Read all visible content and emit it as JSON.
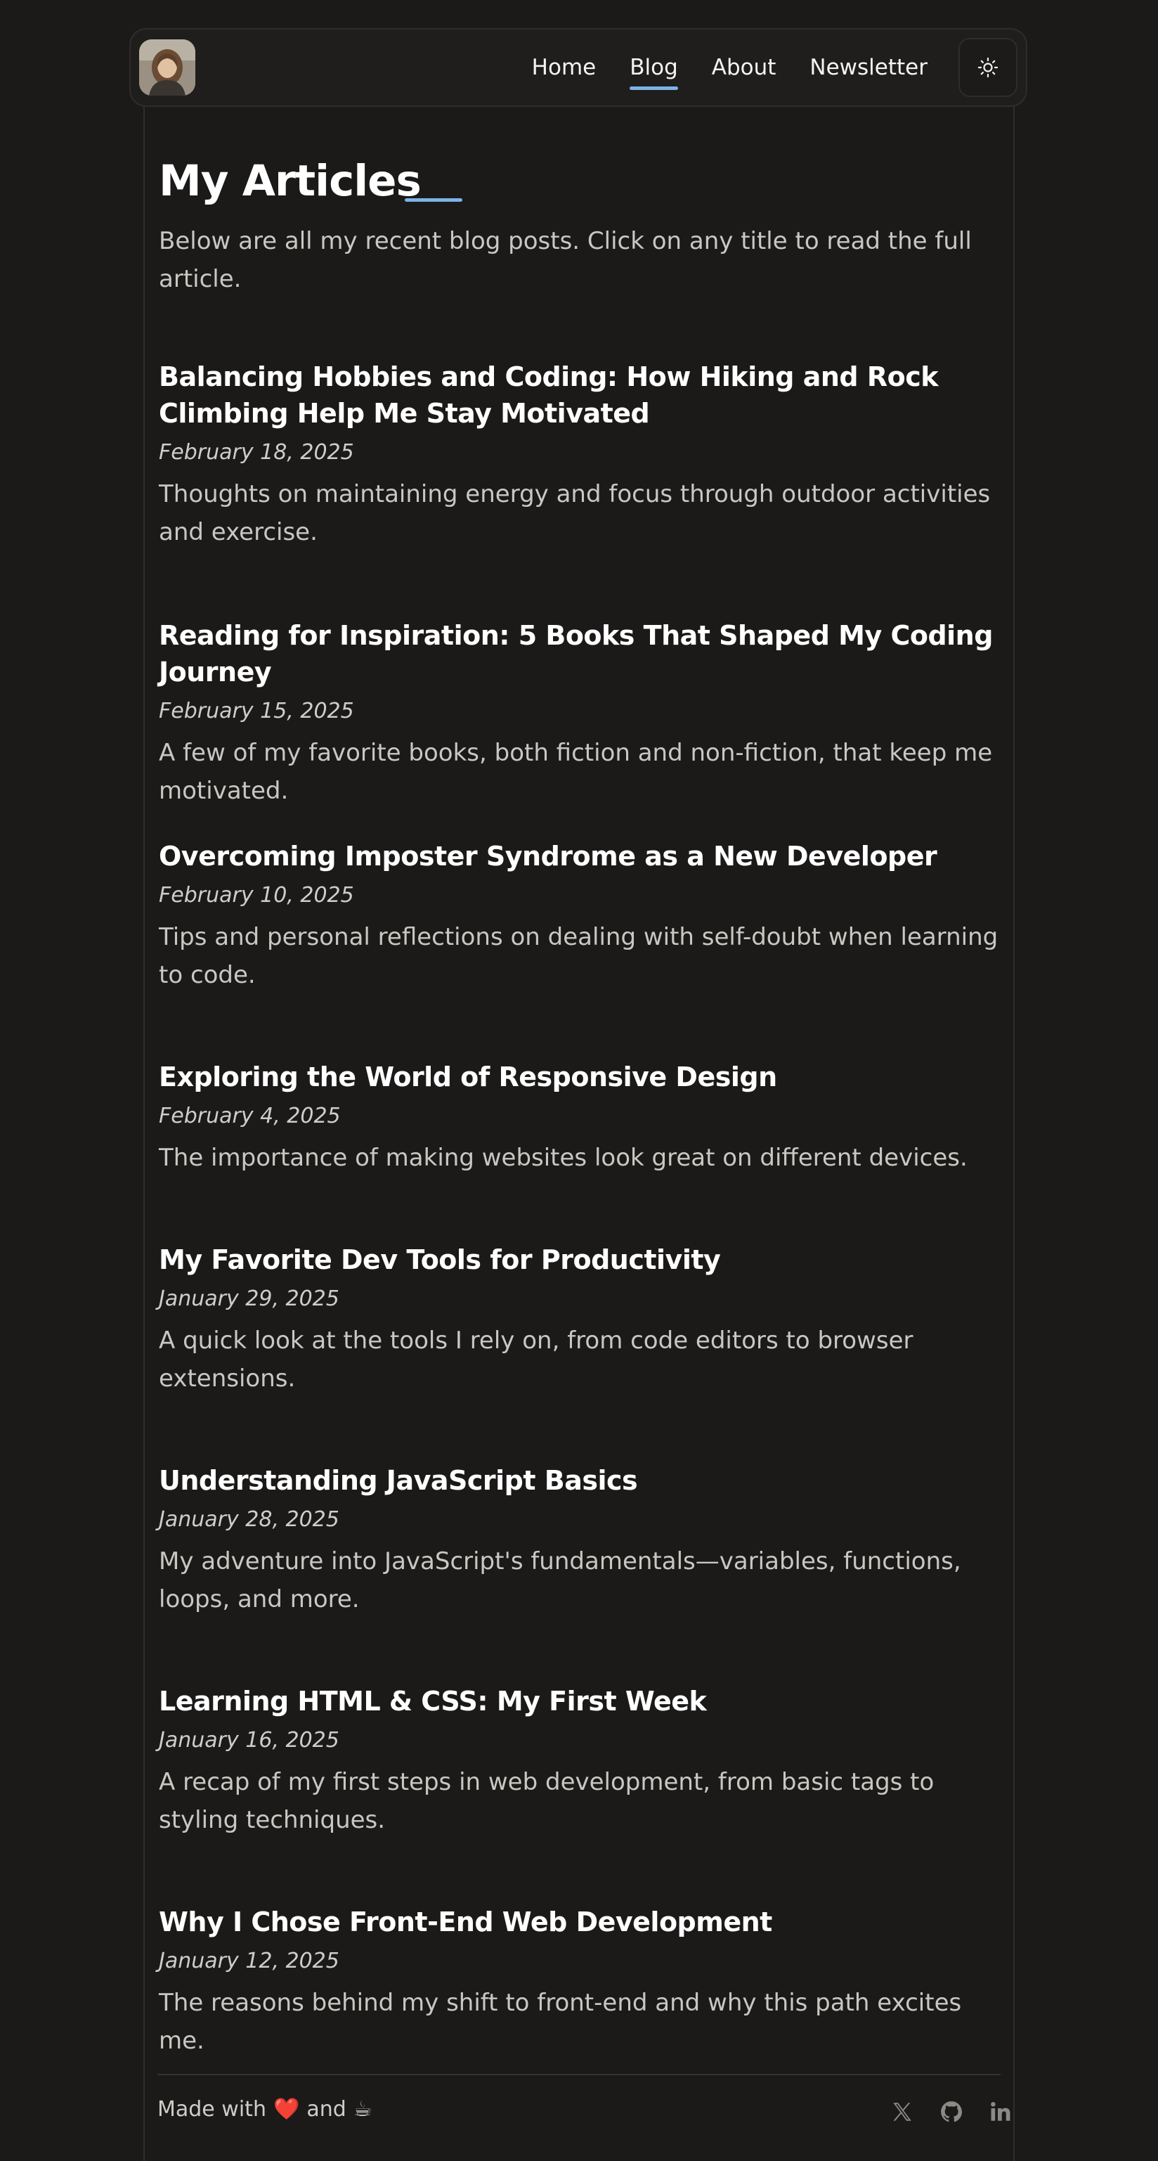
{
  "nav": {
    "links": [
      {
        "label": "Home",
        "active": false
      },
      {
        "label": "Blog",
        "active": true
      },
      {
        "label": "About",
        "active": false
      },
      {
        "label": "Newsletter",
        "active": false
      }
    ],
    "theme_toggle_icon": "sun-icon"
  },
  "page": {
    "title": "My Articles",
    "intro": "Below are all my recent blog posts. Click on any title to read the full article."
  },
  "articles": [
    {
      "title": "Balancing Hobbies and Coding: How Hiking and Rock Climbing Help Me Stay Motivated",
      "date": "February 18, 2025",
      "summary": "Thoughts on maintaining energy and focus through outdoor activities and exercise."
    },
    {
      "title": "Reading for Inspiration: 5 Books That Shaped My Coding Journey",
      "date": "February 15, 2025",
      "summary": "A few of my favorite books, both fiction and non-fiction, that keep me motivated."
    },
    {
      "title": "Overcoming Imposter Syndrome as a New Developer",
      "date": "February 10, 2025",
      "summary": "Tips and personal reflections on dealing with self-doubt when learning to code."
    },
    {
      "title": "Exploring the World of Responsive Design",
      "date": "February 4, 2025",
      "summary": "The importance of making websites look great on different devices."
    },
    {
      "title": "My Favorite Dev Tools for Productivity",
      "date": "January 29, 2025",
      "summary": "A quick look at the tools I rely on, from code editors to browser extensions."
    },
    {
      "title": "Understanding JavaScript Basics",
      "date": "January 28, 2025",
      "summary": "My adventure into JavaScript's fundamentals—variables, functions, loops, and more."
    },
    {
      "title": "Learning HTML & CSS: My First Week",
      "date": "January 16, 2025",
      "summary": "A recap of my first steps in web development, from basic tags to styling techniques."
    },
    {
      "title": "Why I Chose Front-End Web Development",
      "date": "January 12, 2025",
      "summary": "The reasons behind my shift to front-end and why this path excites me."
    }
  ],
  "footer": {
    "made_with": "Made with",
    "heart": "❤️",
    "and": "and",
    "coffee": "☕",
    "social_icons": [
      "x-icon",
      "github-icon",
      "linkedin-icon"
    ]
  },
  "colors": {
    "background": "#1b1a19",
    "accent": "#7fb2e5"
  }
}
